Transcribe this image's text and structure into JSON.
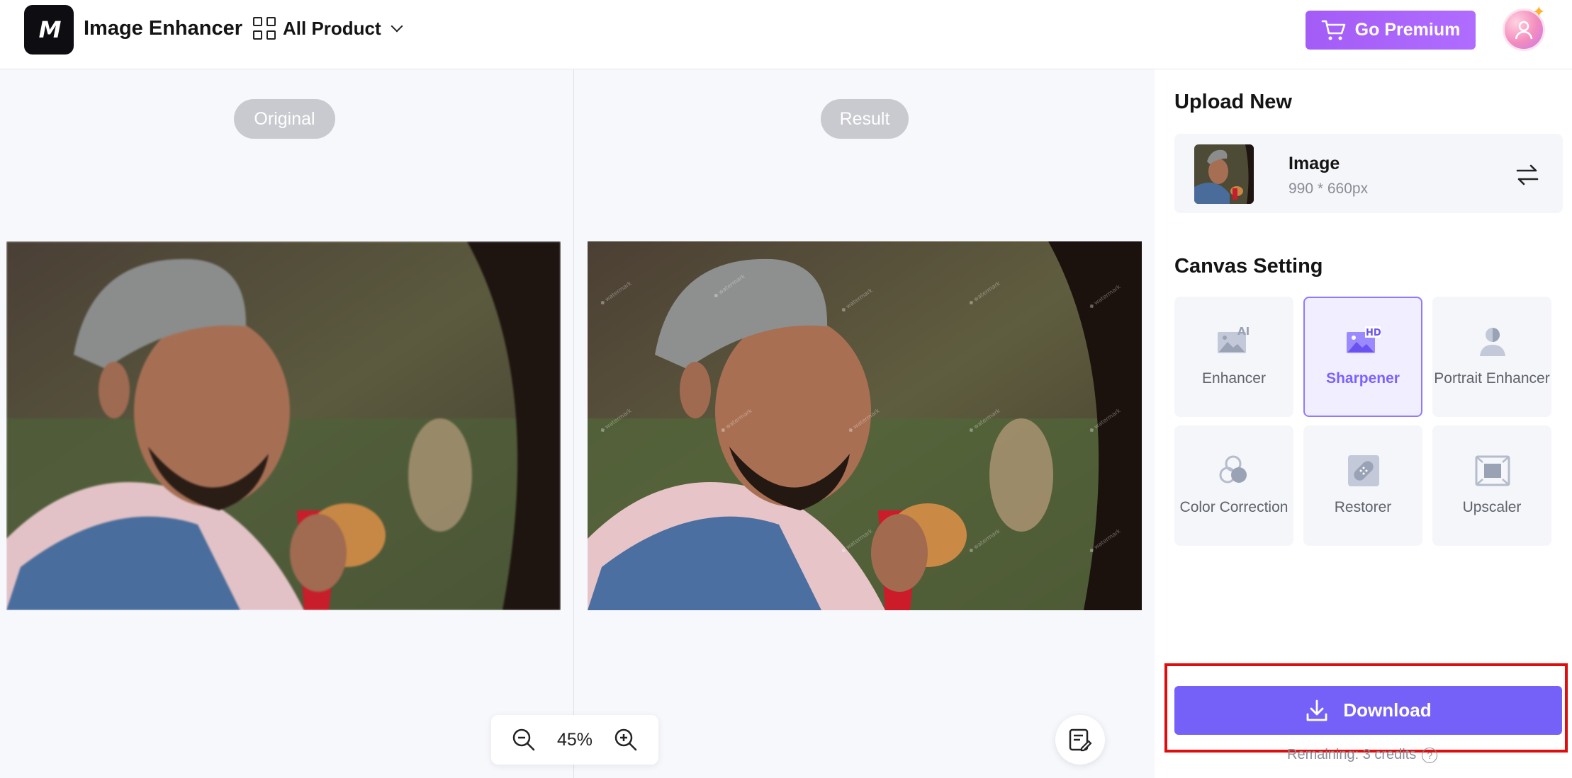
{
  "header": {
    "logo_text": "M",
    "app_title": "Image Enhancer",
    "all_product_label": "All Product",
    "premium_label": "Go Premium",
    "accent_color": "#7561f7",
    "premium_color": "#a35cf6"
  },
  "canvas": {
    "original_label": "Original",
    "result_label": "Result",
    "zoom_level": "45%"
  },
  "sidebar": {
    "upload_title": "Upload New",
    "image": {
      "name": "Image",
      "dimensions": "990 * 660px"
    },
    "canvas_setting_title": "Canvas Setting",
    "tools": [
      {
        "label": "Enhancer",
        "icon": "ai-image-icon",
        "active": false
      },
      {
        "label": "Sharpener",
        "icon": "hd-image-icon",
        "active": true
      },
      {
        "label": "Portrait Enhancer",
        "icon": "portrait-icon",
        "active": false
      },
      {
        "label": "Color Correction",
        "icon": "color-circles-icon",
        "active": false
      },
      {
        "label": "Restorer",
        "icon": "bandage-icon",
        "active": false
      },
      {
        "label": "Upscaler",
        "icon": "upscale-frame-icon",
        "active": false
      }
    ],
    "download_label": "Download",
    "credits_text": "Remaining: 3 credits",
    "help_glyph": "?"
  }
}
